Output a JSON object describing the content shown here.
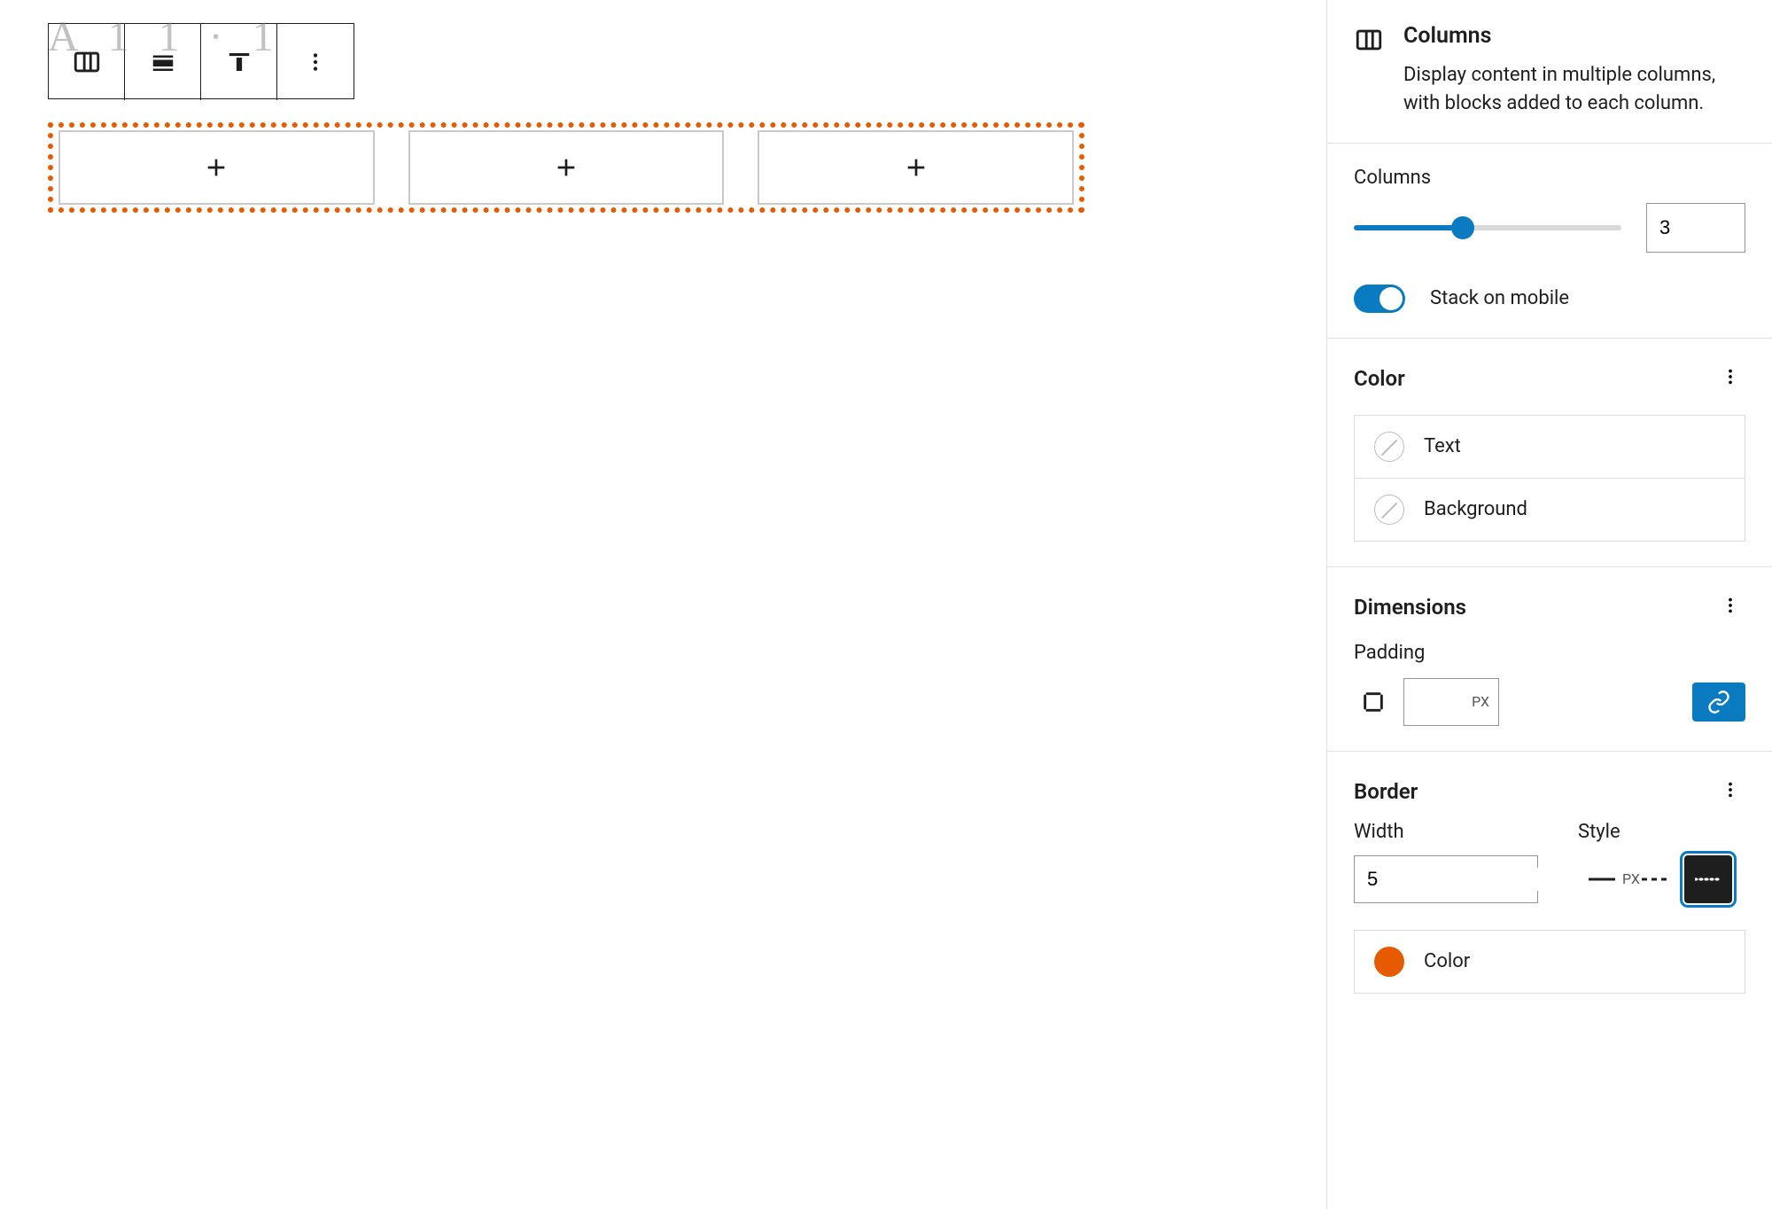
{
  "block": {
    "name": "Columns",
    "description": "Display content in multiple columns, with blocks added to each column."
  },
  "columns_setting": {
    "label": "Columns",
    "value": "3",
    "stack_label": "Stack on mobile"
  },
  "color": {
    "heading": "Color",
    "text_label": "Text",
    "background_label": "Background"
  },
  "dimensions": {
    "heading": "Dimensions",
    "padding_label": "Padding",
    "padding_unit": "PX"
  },
  "border": {
    "heading": "Border",
    "width_label": "Width",
    "width_value": "5",
    "width_unit": "PX",
    "style_label": "Style",
    "color_label": "Color",
    "color_value": "#e65a00"
  }
}
